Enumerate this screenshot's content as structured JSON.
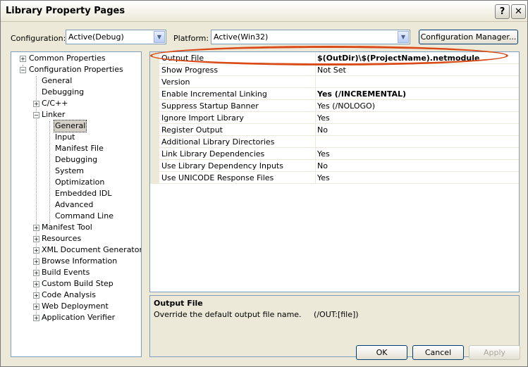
{
  "window": {
    "title": "Library Property Pages",
    "help_label": "?",
    "close_label": "✕"
  },
  "config_bar": {
    "configuration_label": "Configuration:",
    "configuration_value": "Active(Debug)",
    "platform_label": "Platform:",
    "platform_value": "Active(Win32)",
    "manager_button": "Configuration Manager..."
  },
  "tree": {
    "items": [
      {
        "label": "Common Properties"
      },
      {
        "label": "Configuration Properties"
      },
      {
        "label": "General"
      },
      {
        "label": "Debugging"
      },
      {
        "label": "C/C++"
      },
      {
        "label": "Linker"
      },
      {
        "label": "General"
      },
      {
        "label": "Input"
      },
      {
        "label": "Manifest File"
      },
      {
        "label": "Debugging"
      },
      {
        "label": "System"
      },
      {
        "label": "Optimization"
      },
      {
        "label": "Embedded IDL"
      },
      {
        "label": "Advanced"
      },
      {
        "label": "Command Line"
      },
      {
        "label": "Manifest Tool"
      },
      {
        "label": "Resources"
      },
      {
        "label": "XML Document Generator"
      },
      {
        "label": "Browse Information"
      },
      {
        "label": "Build Events"
      },
      {
        "label": "Custom Build Step"
      },
      {
        "label": "Code Analysis"
      },
      {
        "label": "Web Deployment"
      },
      {
        "label": "Application Verifier"
      }
    ]
  },
  "properties": [
    {
      "name": "Output File",
      "value": "$(OutDir)\\$(ProjectName).netmodule"
    },
    {
      "name": "Show Progress",
      "value": "Not Set"
    },
    {
      "name": "Version",
      "value": ""
    },
    {
      "name": "Enable Incremental Linking",
      "value": "Yes (/INCREMENTAL)"
    },
    {
      "name": "Suppress Startup Banner",
      "value": "Yes (/NOLOGO)"
    },
    {
      "name": "Ignore Import Library",
      "value": "Yes"
    },
    {
      "name": "Register Output",
      "value": "No"
    },
    {
      "name": "Additional Library Directories",
      "value": ""
    },
    {
      "name": "Link Library Dependencies",
      "value": "Yes"
    },
    {
      "name": "Use Library Dependency Inputs",
      "value": "No"
    },
    {
      "name": "Use UNICODE Response Files",
      "value": "Yes"
    }
  ],
  "description": {
    "title": "Output File",
    "text": "Override the default output file name.     (/OUT:[file])"
  },
  "buttons": {
    "ok": "OK",
    "cancel": "Cancel",
    "apply": "Apply"
  },
  "colors": {
    "highlight_oval": "#d94a17"
  }
}
